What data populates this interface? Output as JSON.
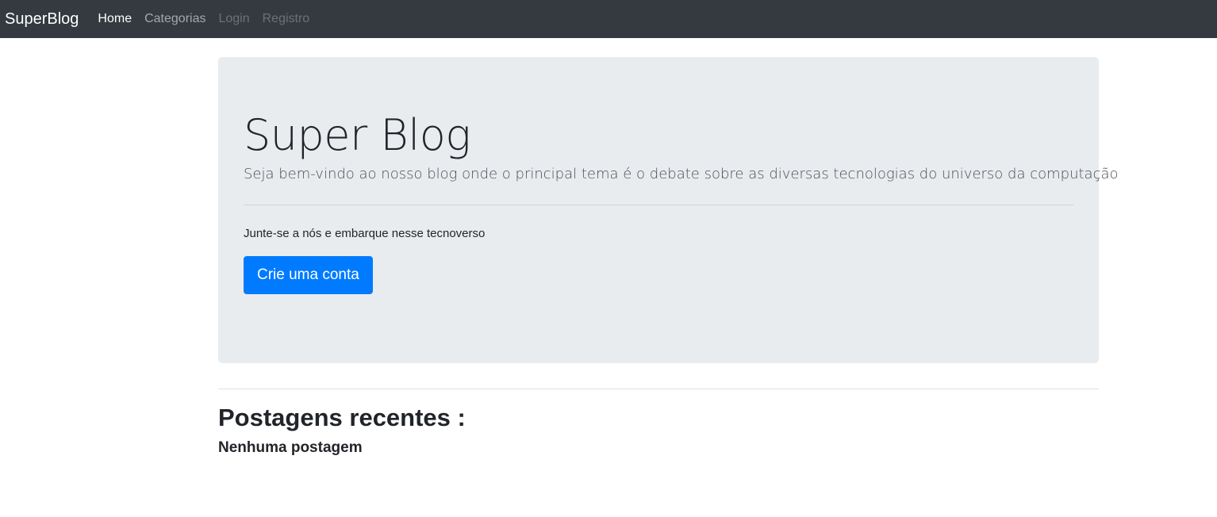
{
  "navbar": {
    "brand": "SuperBlog",
    "links": [
      {
        "label": "Home",
        "state": "active"
      },
      {
        "label": "Categorias",
        "state": "normal"
      },
      {
        "label": "Login",
        "state": "muted"
      },
      {
        "label": "Registro",
        "state": "muted"
      }
    ]
  },
  "jumbotron": {
    "title": "Super Blog",
    "lead": "Seja bem-vindo ao nosso blog onde o principal tema é o debate sobre as diversas tecnologias do universo da computação",
    "text": "Junte-se a nós e embarque nesse tecnoverso",
    "button_label": "Crie uma conta"
  },
  "posts": {
    "title": "Postagens recentes :",
    "empty_message": "Nenhuma postagem"
  },
  "colors": {
    "navbar_bg": "#343a40",
    "jumbotron_bg": "#e9ecef",
    "primary": "#007bff"
  }
}
